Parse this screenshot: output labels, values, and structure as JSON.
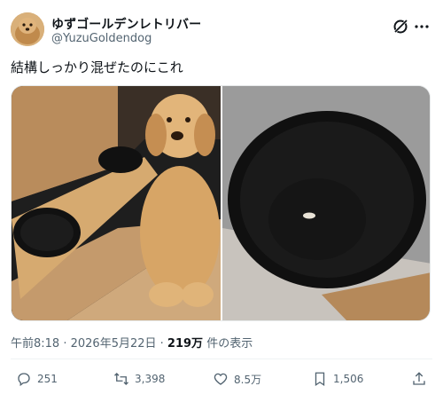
{
  "author": {
    "display_name": "ゆずゴールデンレトリバー",
    "handle": "@YuzuGoldendog"
  },
  "tweet": {
    "text": "結構しっかり混ぜたのにこれ"
  },
  "meta": {
    "time": "午前8:18",
    "separator": " · ",
    "date": "2026年5月22日",
    "views_count": "219万",
    "views_label": " 件の表示"
  },
  "actions": {
    "replies": "251",
    "reposts": "3,398",
    "likes": "8.5万",
    "bookmarks": "1,506"
  },
  "colors": {
    "text_primary": "#0f1419",
    "text_secondary": "#536471",
    "divider": "#eff3f4"
  },
  "icons": [
    "grok-icon",
    "more-icon",
    "reply-icon",
    "repost-icon",
    "like-icon",
    "bookmark-icon",
    "share-icon"
  ]
}
